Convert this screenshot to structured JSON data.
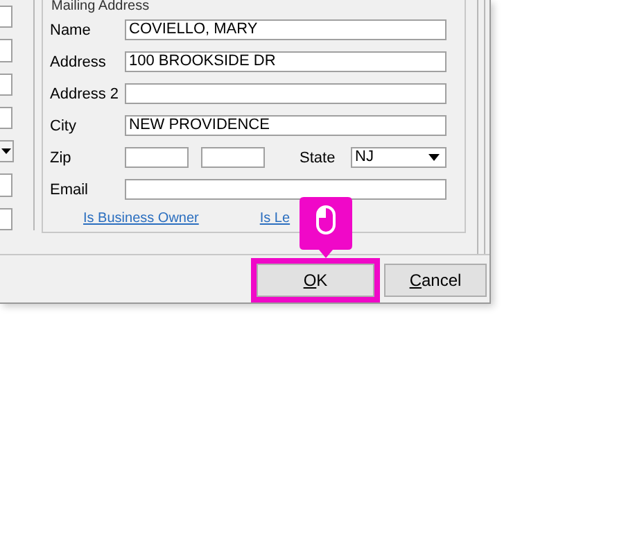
{
  "left_panel": {
    "fields": [
      {
        "kind": "text"
      },
      {
        "kind": "text"
      },
      {
        "kind": "text"
      },
      {
        "kind": "text"
      },
      {
        "kind": "dropdown"
      },
      {
        "kind": "text"
      },
      {
        "kind": "text"
      }
    ]
  },
  "mailing_address": {
    "title": "Mailing Address",
    "rows": [
      {
        "label": "Name",
        "value": "COVIELLO, MARY"
      },
      {
        "label": "Address",
        "value": "100 BROOKSIDE DR"
      },
      {
        "label": "Address 2",
        "value": ""
      },
      {
        "label": "City",
        "value": "NEW PROVIDENCE"
      }
    ],
    "zip": {
      "label": "Zip"
    },
    "state": {
      "label": "State",
      "value": "NJ"
    },
    "email": {
      "label": "Email"
    },
    "links": [
      "Is Business Owner",
      "Is Le"
    ]
  },
  "buttons": [
    {
      "label": "OK",
      "highlighted": true
    },
    {
      "label": "Cancel",
      "highlighted": false
    }
  ]
}
